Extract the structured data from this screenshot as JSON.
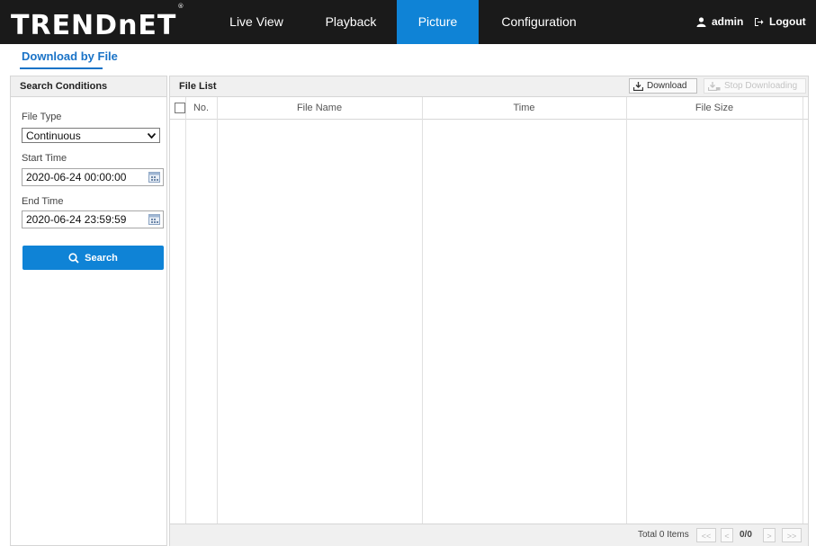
{
  "header": {
    "logo": "TRENDnET",
    "logo_mark": "®",
    "nav": [
      {
        "label": "Live View"
      },
      {
        "label": "Playback"
      },
      {
        "label": "Picture"
      },
      {
        "label": "Configuration"
      }
    ],
    "active_nav": "Picture",
    "user": "admin",
    "logout": "Logout",
    "accent_color": "#0f83d6"
  },
  "subtab": {
    "label": "Download by File"
  },
  "search_conditions": {
    "title": "Search Conditions",
    "file_type_label": "File Type",
    "file_type_value": "Continuous",
    "start_time_label": "Start Time",
    "start_time_value": "2020-06-24 00:00:00",
    "end_time_label": "End Time",
    "end_time_value": "2020-06-24 23:59:59",
    "search_button": "Search"
  },
  "file_list": {
    "title": "File List",
    "download_button": "Download",
    "stop_download_button": "Stop Downloading",
    "columns": [
      "No.",
      "File Name",
      "Time",
      "File Size"
    ],
    "rows": [],
    "footer": {
      "total": "Total 0 Items",
      "first": "<<",
      "prev": "<",
      "page": "0/0",
      "next": ">",
      "last": ">>"
    }
  }
}
